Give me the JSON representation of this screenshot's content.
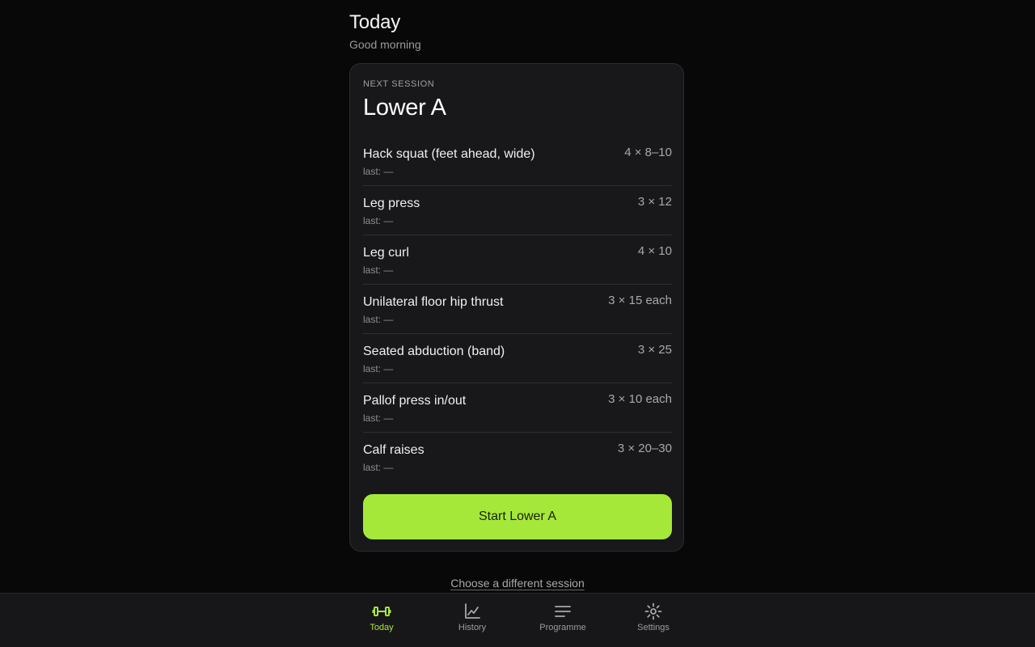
{
  "header": {
    "title": "Today",
    "greeting": "Good morning"
  },
  "session": {
    "eyebrow": "Next session",
    "name": "Lower A",
    "exercises": [
      {
        "name": "Hack squat (feet ahead, wide)",
        "last": "last: —",
        "sets": "4 × 8–10"
      },
      {
        "name": "Leg press",
        "last": "last: —",
        "sets": "3 × 12"
      },
      {
        "name": "Leg curl",
        "last": "last: —",
        "sets": "4 × 10"
      },
      {
        "name": "Unilateral floor hip thrust",
        "last": "last: —",
        "sets": "3 × 15 each"
      },
      {
        "name": "Seated abduction (band)",
        "last": "last: —",
        "sets": "3 × 25"
      },
      {
        "name": "Pallof press in/out",
        "last": "last: —",
        "sets": "3 × 10 each"
      },
      {
        "name": "Calf raises",
        "last": "last: —",
        "sets": "3 × 20–30"
      }
    ],
    "start_label": "Start Lower A"
  },
  "alt_link": "Choose a different session",
  "nav": {
    "items": [
      {
        "label": "Today",
        "icon": "dumbbell-icon",
        "active": true
      },
      {
        "label": "History",
        "icon": "chart-line-icon",
        "active": false
      },
      {
        "label": "Programme",
        "icon": "list-lines-icon",
        "active": false
      },
      {
        "label": "Settings",
        "icon": "sun-gear-icon",
        "active": false
      }
    ]
  },
  "colors": {
    "accent": "#a6e83a",
    "background": "#080808",
    "card": "#18181a",
    "nav_bg": "#171719"
  }
}
